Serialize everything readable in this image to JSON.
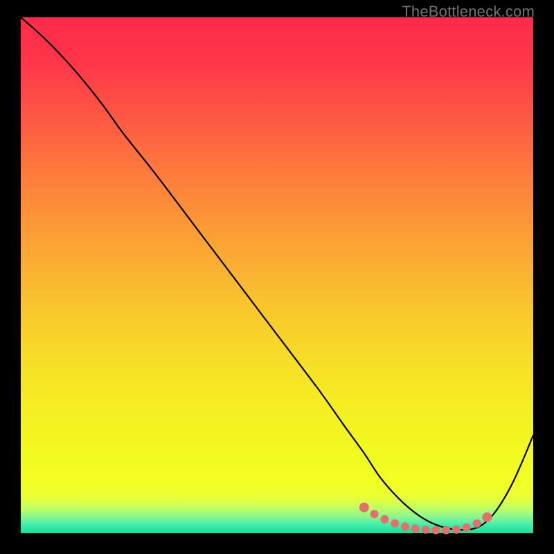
{
  "watermark": "TheBottleneck.com",
  "gradient_stops": [
    {
      "offset": 0.0,
      "color": "#ff2b49"
    },
    {
      "offset": 0.08,
      "color": "#ff3449"
    },
    {
      "offset": 0.18,
      "color": "#fe5344"
    },
    {
      "offset": 0.3,
      "color": "#fd7a3d"
    },
    {
      "offset": 0.42,
      "color": "#fb9e36"
    },
    {
      "offset": 0.55,
      "color": "#f9c32d"
    },
    {
      "offset": 0.68,
      "color": "#f6e126"
    },
    {
      "offset": 0.78,
      "color": "#f4f221"
    },
    {
      "offset": 0.86,
      "color": "#f1fb20"
    },
    {
      "offset": 0.905,
      "color": "#f4ff26"
    },
    {
      "offset": 0.93,
      "color": "#e8ff36"
    },
    {
      "offset": 0.95,
      "color": "#c5fe60"
    },
    {
      "offset": 0.968,
      "color": "#8bf78f"
    },
    {
      "offset": 0.982,
      "color": "#4beeac"
    },
    {
      "offset": 0.992,
      "color": "#27e8a4"
    },
    {
      "offset": 1.0,
      "color": "#14e38a"
    }
  ],
  "chart_data": {
    "type": "line",
    "title": "",
    "xlabel": "",
    "ylabel": "",
    "xlim": [
      0,
      100
    ],
    "ylim": [
      0,
      100
    ],
    "ylim_inverted": false,
    "grid": false,
    "legend": false,
    "background": "red-yellow-green vertical gradient (bottleneck heatmap)",
    "series": [
      {
        "name": "main-curve",
        "color": "#000000",
        "x": [
          0,
          4,
          8,
          12,
          16,
          20,
          26,
          34,
          42,
          50,
          58,
          63,
          67,
          70,
          73,
          76,
          79,
          82,
          85,
          88,
          90,
          92,
          94,
          96,
          98,
          100
        ],
        "y": [
          100,
          96.5,
          92.5,
          88,
          83,
          77.5,
          70,
          59.5,
          49,
          38.5,
          28,
          21,
          15.5,
          11,
          7.5,
          4.7,
          2.6,
          1.3,
          0.7,
          0.8,
          1.6,
          3.4,
          6.2,
          9.8,
          14.2,
          19
        ]
      },
      {
        "name": "highlight-dots",
        "color": "#e56f6c",
        "marker": "circle",
        "x": [
          67,
          69,
          71,
          73,
          75,
          77,
          79,
          81,
          83,
          85,
          87,
          89,
          91
        ],
        "y": [
          5.0,
          3.7,
          2.7,
          1.9,
          1.3,
          0.9,
          0.7,
          0.6,
          0.6,
          0.7,
          1.1,
          1.9,
          3.1
        ]
      }
    ]
  }
}
